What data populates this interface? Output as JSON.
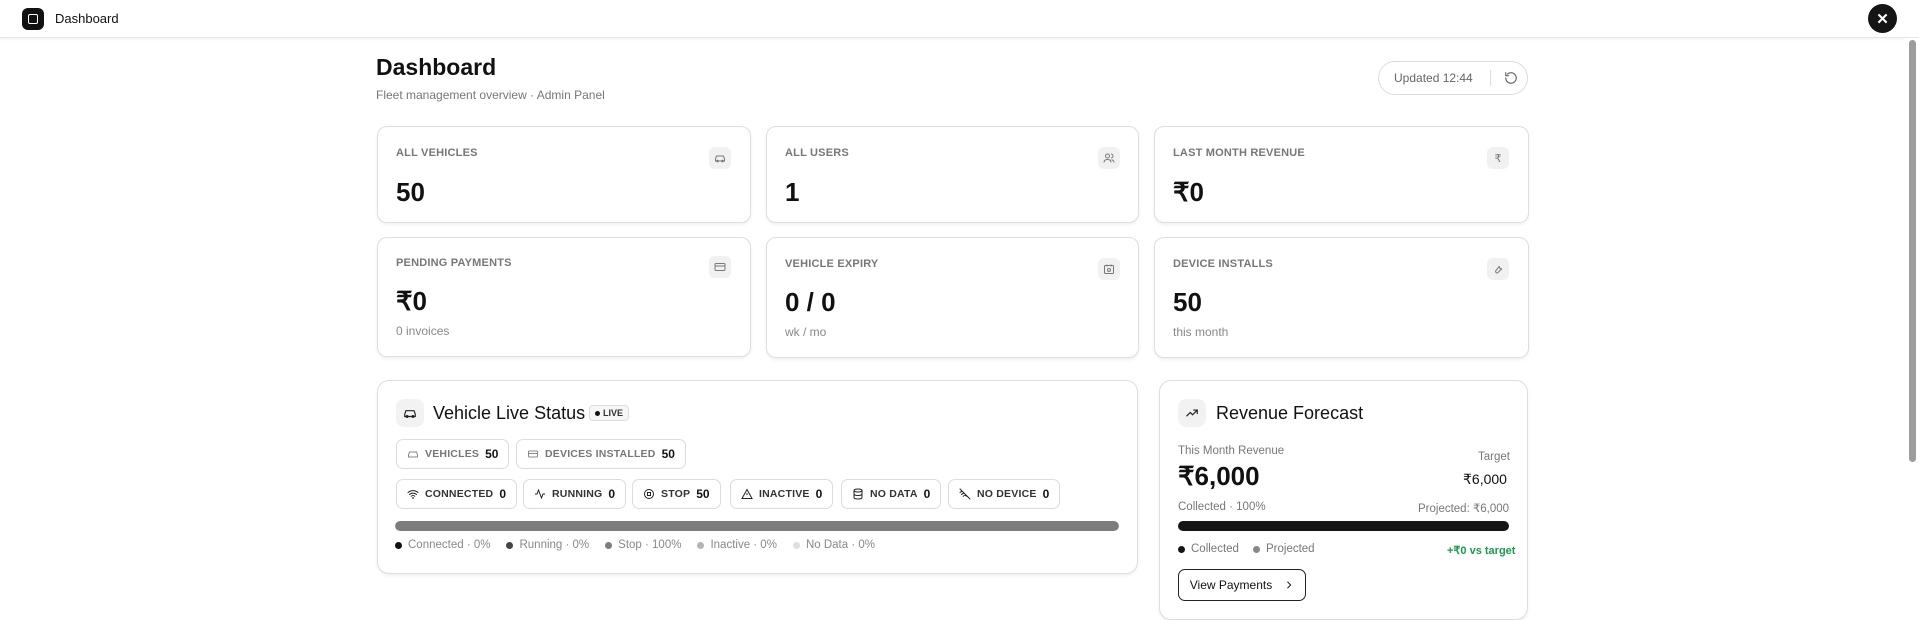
{
  "app": {
    "title": "Dashboard"
  },
  "header": {
    "title": "Dashboard",
    "subtitle": "Fleet management overview · Admin Panel",
    "updated": "Updated 12:44"
  },
  "stats": [
    {
      "label": "ALL VEHICLES",
      "value": "50",
      "sub": "",
      "icon": "car-icon"
    },
    {
      "label": "ALL USERS",
      "value": "1",
      "sub": "",
      "icon": "users-icon"
    },
    {
      "label": "LAST MONTH REVENUE",
      "value": "₹0",
      "sub": "",
      "icon": "rupee-icon"
    },
    {
      "label": "PENDING PAYMENTS",
      "value": "₹0",
      "sub": "0 invoices",
      "icon": "credit-card-icon"
    },
    {
      "label": "VEHICLE EXPIRY",
      "value": "0 / 0",
      "sub": "wk / mo",
      "icon": "calendar-icon"
    },
    {
      "label": "DEVICE INSTALLS",
      "value": "50",
      "sub": "this month",
      "icon": "wrench-icon"
    }
  ],
  "live_status": {
    "title": "Vehicle Live Status",
    "badge": "LIVE",
    "summary": [
      {
        "label": "VEHICLES",
        "count": "50"
      },
      {
        "label": "DEVICES INSTALLED",
        "count": "50"
      }
    ],
    "states": [
      {
        "label": "CONNECTED",
        "count": "0"
      },
      {
        "label": "RUNNING",
        "count": "0"
      },
      {
        "label": "STOP",
        "count": "50"
      },
      {
        "label": "INACTIVE",
        "count": "0"
      },
      {
        "label": "NO DATA",
        "count": "0"
      },
      {
        "label": "NO DEVICE",
        "count": "0"
      }
    ],
    "stop_share_percent": 100,
    "legend": [
      {
        "text": "Connected · 0%",
        "color": "#111111"
      },
      {
        "text": "Running · 0%",
        "color": "#444444"
      },
      {
        "text": "Stop · 100%",
        "color": "#7d7d7d"
      },
      {
        "text": "Inactive · 0%",
        "color": "#b5b5b5"
      },
      {
        "text": "No Data · 0%",
        "color": "#dedede"
      }
    ]
  },
  "forecast": {
    "title": "Revenue Forecast",
    "month_label": "This Month Revenue",
    "month_value": "₹6,000",
    "target_label": "Target",
    "target_value": "₹6,000",
    "collected_text": "Collected · 100%",
    "projected_text": "Projected: ₹6,000",
    "collected_percent": 100,
    "legend_collected": "Collected",
    "legend_projected": "Projected",
    "vs_target": "+₹0 vs target",
    "vs_target_color": "#1a9a4a",
    "button": "View Payments"
  }
}
